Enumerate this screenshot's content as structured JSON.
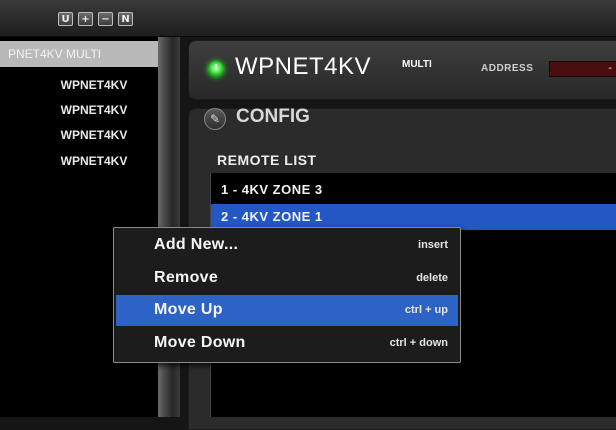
{
  "toolbar": {
    "buttons": [
      {
        "label": "U",
        "icon": "update-icon"
      },
      {
        "label": "+",
        "icon": "plus-icon"
      },
      {
        "label": "−",
        "icon": "minus-icon"
      },
      {
        "label": "N",
        "icon": "new-icon"
      }
    ]
  },
  "sidebar": {
    "items": [
      {
        "label": "PNET4KV MULTI",
        "selected": true
      },
      {
        "label": "WPNET4KV",
        "selected": false
      },
      {
        "label": "WPNET4KV",
        "selected": false
      },
      {
        "label": "WPNET4KV",
        "selected": false
      },
      {
        "label": "WPNET4KV",
        "selected": false
      }
    ]
  },
  "device": {
    "title": "WPNET4KV",
    "subtitle": "MULTI",
    "power_state": "on",
    "address_label": "ADDRESS",
    "address_value": "-"
  },
  "config": {
    "title": "CONFIG",
    "remote_list_label": "REMOTE LIST",
    "remotes": [
      {
        "label": "1 - 4KV ZONE 3",
        "selected": false
      },
      {
        "label": "2 - 4KV ZONE 1",
        "selected": true
      }
    ]
  },
  "context_menu": {
    "items": [
      {
        "label": "Add New...",
        "shortcut": "insert",
        "highlighted": false
      },
      {
        "label": "Remove",
        "shortcut": "delete",
        "highlighted": false
      },
      {
        "label": "Move Up",
        "shortcut": "ctrl + up",
        "highlighted": true
      },
      {
        "label": "Move Down",
        "shortcut": "ctrl + down",
        "highlighted": false
      }
    ]
  },
  "colors": {
    "selection_blue": "#2257c4",
    "menu_highlight": "#2e63c6",
    "power_green": "#4ff04f",
    "address_field": "#4a0e0e"
  }
}
